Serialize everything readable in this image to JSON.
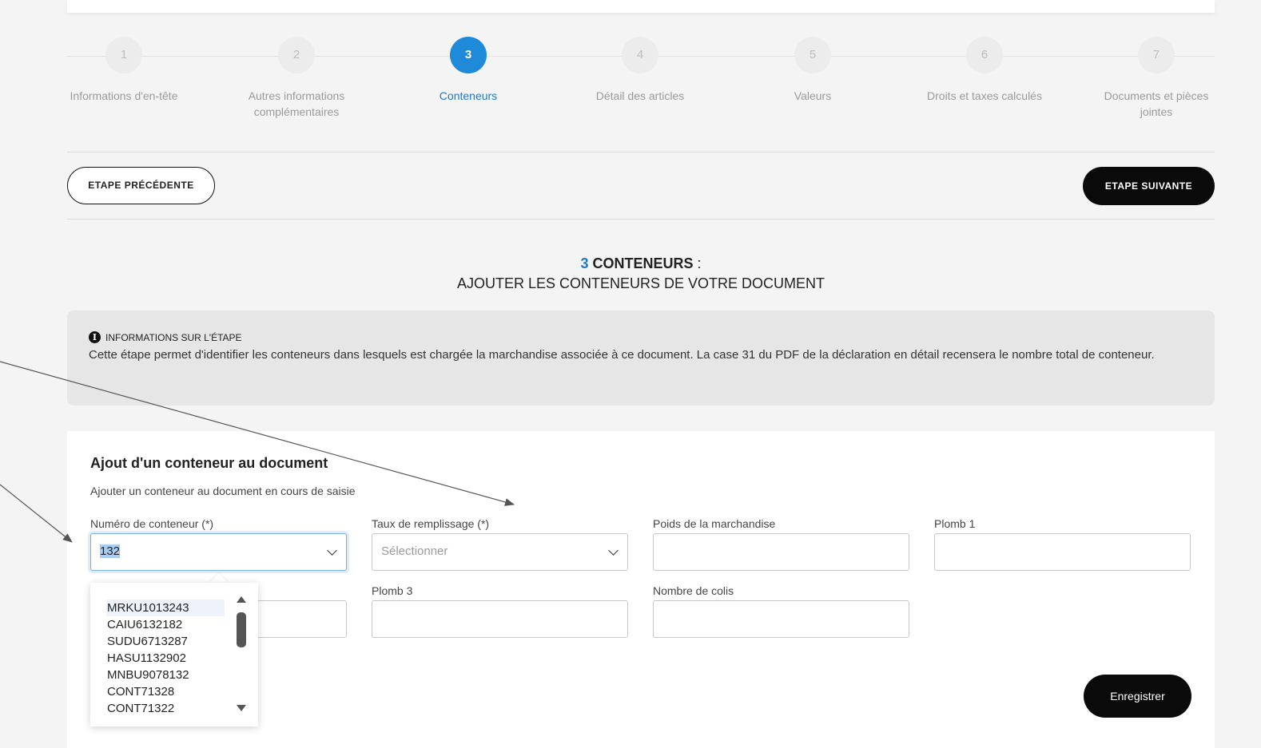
{
  "stepper": {
    "steps": [
      {
        "number": "1",
        "label": "Informations d'en-tête"
      },
      {
        "number": "2",
        "label": "Autres informations complémentaires"
      },
      {
        "number": "3",
        "label": "Conteneurs"
      },
      {
        "number": "4",
        "label": "Détail des articles"
      },
      {
        "number": "5",
        "label": "Valeurs"
      },
      {
        "number": "6",
        "label": "Droits et taxes calculés"
      },
      {
        "number": "7",
        "label": "Documents et pièces jointes"
      }
    ],
    "active_step": 3
  },
  "nav": {
    "prev_label": "ETAPE PRÉCÉDENTE",
    "next_label": "ETAPE SUIVANTE"
  },
  "section": {
    "number": "3",
    "title": "CONTENEURS",
    "colon": " :",
    "subtitle": "AJOUTER LES CONTENEURS DE VOTRE DOCUMENT"
  },
  "info": {
    "heading": "INFORMATIONS SUR L'ÉTAPE",
    "text": "Cette étape permet d'identifier les conteneurs dans lesquels est chargée la marchandise associée à ce document. La case 31 du PDF de la déclaration en détail recensera le nombre total de conteneur."
  },
  "form": {
    "title": "Ajout d'un conteneur au document",
    "subtitle": "Ajouter un conteneur au document en cours de saisie",
    "container_number_label": "Numéro de conteneur (*)",
    "container_number_value": "132",
    "fill_rate_label": "Taux de remplissage (*)",
    "fill_rate_placeholder": "Sélectionner",
    "weight_label": "Poids de la marchandise",
    "seal1_label": "Plomb 1",
    "seal3_label": "Plomb 3",
    "packages_label": "Nombre de colis",
    "save_label": "Enregistrer"
  },
  "dropdown": {
    "items": [
      "MRKU1013243",
      "CAIU6132182",
      "SUDU6713287",
      "HASU1132902",
      "MNBU9078132",
      "CONT71328",
      "CONT71322"
    ],
    "highlighted_index": 0
  },
  "colors": {
    "accent": "#1f8ad9",
    "primary_button": "#0a0a0a",
    "info_background": "#e6e6e6"
  }
}
